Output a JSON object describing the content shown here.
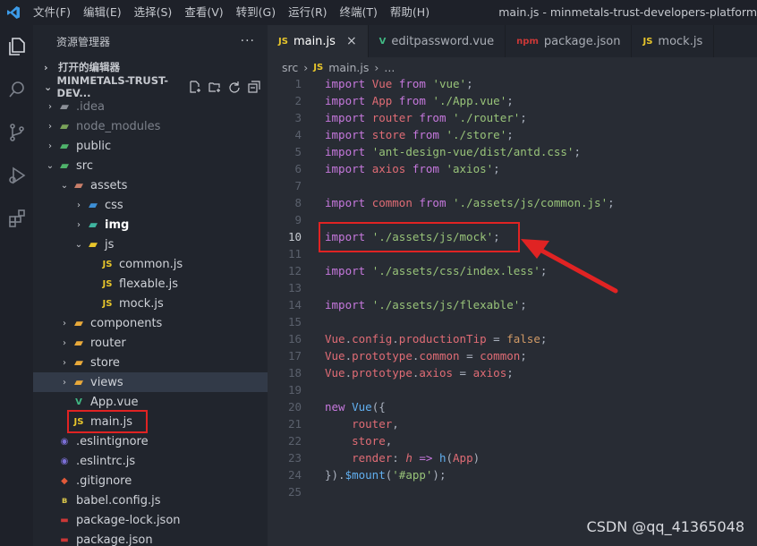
{
  "titlebar": {
    "menu": [
      "文件(F)",
      "编辑(E)",
      "选择(S)",
      "查看(V)",
      "转到(G)",
      "运行(R)",
      "终端(T)",
      "帮助(H)"
    ],
    "window_title": "main.js - minmetals-trust-developers-platform"
  },
  "sidebar": {
    "title": "资源管理器",
    "more": "···",
    "open_editors": "打开的编辑器",
    "project": "MINMETALS-TRUST-DEV...",
    "tree": [
      {
        "label": ".idea",
        "type": "folder",
        "icon": "idea-folder-icon",
        "depth": 1,
        "expanded": false,
        "dim": true
      },
      {
        "label": "node_modules",
        "type": "folder",
        "icon": "node-folder-icon",
        "depth": 1,
        "expanded": false,
        "dim": true
      },
      {
        "label": "public",
        "type": "folder",
        "icon": "public-folder-icon",
        "depth": 1,
        "expanded": false
      },
      {
        "label": "src",
        "type": "folder",
        "icon": "src-folder-icon",
        "depth": 1,
        "expanded": true
      },
      {
        "label": "assets",
        "type": "folder",
        "icon": "assets-folder-icon",
        "depth": 2,
        "expanded": true
      },
      {
        "label": "css",
        "type": "folder",
        "icon": "css-folder-icon",
        "depth": 3,
        "expanded": false
      },
      {
        "label": "img",
        "type": "folder",
        "icon": "img-folder-icon",
        "depth": 3,
        "expanded": false,
        "bold": true
      },
      {
        "label": "js",
        "type": "folder",
        "icon": "js-folder-icon",
        "depth": 3,
        "expanded": true
      },
      {
        "label": "common.js",
        "type": "js",
        "icon": "js-file-icon",
        "depth": 4
      },
      {
        "label": "flexable.js",
        "type": "js",
        "icon": "js-file-icon",
        "depth": 4
      },
      {
        "label": "mock.js",
        "type": "js",
        "icon": "js-file-icon",
        "depth": 4
      },
      {
        "label": "components",
        "type": "folder",
        "icon": "components-folder-icon",
        "depth": 2,
        "expanded": false
      },
      {
        "label": "router",
        "type": "folder",
        "icon": "router-folder-icon",
        "depth": 2,
        "expanded": false
      },
      {
        "label": "store",
        "type": "folder",
        "icon": "store-folder-icon",
        "depth": 2,
        "expanded": false
      },
      {
        "label": "views",
        "type": "folder",
        "icon": "views-folder-icon",
        "depth": 2,
        "expanded": false,
        "selected": true
      },
      {
        "label": "App.vue",
        "type": "vue",
        "icon": "vue-file-icon",
        "depth": 2
      },
      {
        "label": "main.js",
        "type": "js",
        "icon": "js-file-icon",
        "depth": 2,
        "boxed": true
      },
      {
        "label": ".eslintignore",
        "type": "eslint",
        "icon": "eslint-file-icon",
        "depth": 1
      },
      {
        "label": ".eslintrc.js",
        "type": "eslint",
        "icon": "eslint-file-icon",
        "depth": 1
      },
      {
        "label": ".gitignore",
        "type": "git",
        "icon": "git-file-icon",
        "depth": 1
      },
      {
        "label": "babel.config.js",
        "type": "babel",
        "icon": "babel-file-icon",
        "depth": 1
      },
      {
        "label": "package-lock.json",
        "type": "npm",
        "icon": "npm-file-icon",
        "depth": 1
      },
      {
        "label": "package.json",
        "type": "npm",
        "icon": "npm-file-icon",
        "depth": 1
      }
    ]
  },
  "tabs": [
    {
      "label": "main.js",
      "icon": "js-file-icon",
      "badge": "JS",
      "active": true,
      "close": "×"
    },
    {
      "label": "editpassword.vue",
      "icon": "vue-file-icon",
      "badge": "V",
      "active": false
    },
    {
      "label": "package.json",
      "icon": "npm-file-icon",
      "badge": "npm",
      "active": false
    },
    {
      "label": "mock.js",
      "icon": "js-file-icon",
      "badge": "JS",
      "active": false
    }
  ],
  "breadcrumb": {
    "folder": "src",
    "sep": "›",
    "file_badge": "JS",
    "file": "main.js",
    "more": "..."
  },
  "current_line": 10,
  "code_lines": [
    [
      [
        "kw",
        "import "
      ],
      [
        "id",
        "Vue "
      ],
      [
        "kw",
        "from "
      ],
      [
        "str",
        "'vue'"
      ],
      [
        "pl",
        ";"
      ]
    ],
    [
      [
        "kw",
        "import "
      ],
      [
        "id",
        "App "
      ],
      [
        "kw",
        "from "
      ],
      [
        "str",
        "'./App.vue'"
      ],
      [
        "pl",
        ";"
      ]
    ],
    [
      [
        "kw",
        "import "
      ],
      [
        "id",
        "router "
      ],
      [
        "kw",
        "from "
      ],
      [
        "str",
        "'./router'"
      ],
      [
        "pl",
        ";"
      ]
    ],
    [
      [
        "kw",
        "import "
      ],
      [
        "id",
        "store "
      ],
      [
        "kw",
        "from "
      ],
      [
        "str",
        "'./store'"
      ],
      [
        "pl",
        ";"
      ]
    ],
    [
      [
        "kw",
        "import "
      ],
      [
        "str",
        "'ant-design-vue/dist/antd.css'"
      ],
      [
        "pl",
        ";"
      ]
    ],
    [
      [
        "kw",
        "import "
      ],
      [
        "id",
        "axios "
      ],
      [
        "kw",
        "from "
      ],
      [
        "str",
        "'axios'"
      ],
      [
        "pl",
        ";"
      ]
    ],
    [],
    [
      [
        "kw",
        "import "
      ],
      [
        "id",
        "common "
      ],
      [
        "kw",
        "from "
      ],
      [
        "str",
        "'./assets/js/common.js'"
      ],
      [
        "pl",
        ";"
      ]
    ],
    [],
    [
      [
        "kw",
        "import "
      ],
      [
        "str",
        "'./assets/js/mock'"
      ],
      [
        "pl",
        ";"
      ]
    ],
    [],
    [
      [
        "kw",
        "import "
      ],
      [
        "str",
        "'./assets/css/index.less'"
      ],
      [
        "pl",
        ";"
      ]
    ],
    [],
    [
      [
        "kw",
        "import "
      ],
      [
        "str",
        "'./assets/js/flexable'"
      ],
      [
        "pl",
        ";"
      ]
    ],
    [],
    [
      [
        "id",
        "Vue"
      ],
      [
        "pl",
        "."
      ],
      [
        "id",
        "config"
      ],
      [
        "pl",
        "."
      ],
      [
        "id",
        "productionTip "
      ],
      [
        "pl",
        "= "
      ],
      [
        "num",
        "false"
      ],
      [
        "pl",
        ";"
      ]
    ],
    [
      [
        "id",
        "Vue"
      ],
      [
        "pl",
        "."
      ],
      [
        "id",
        "prototype"
      ],
      [
        "pl",
        "."
      ],
      [
        "id",
        "common "
      ],
      [
        "pl",
        "= "
      ],
      [
        "id",
        "common"
      ],
      [
        "pl",
        ";"
      ]
    ],
    [
      [
        "id",
        "Vue"
      ],
      [
        "pl",
        "."
      ],
      [
        "id",
        "prototype"
      ],
      [
        "pl",
        "."
      ],
      [
        "id",
        "axios "
      ],
      [
        "pl",
        "= "
      ],
      [
        "id",
        "axios"
      ],
      [
        "pl",
        ";"
      ]
    ],
    [],
    [
      [
        "kw",
        "new "
      ],
      [
        "fn",
        "Vue"
      ],
      [
        "pl",
        "({"
      ]
    ],
    [
      [
        "pl",
        "    "
      ],
      [
        "id",
        "router"
      ],
      [
        "pl",
        ","
      ]
    ],
    [
      [
        "pl",
        "    "
      ],
      [
        "id",
        "store"
      ],
      [
        "pl",
        ","
      ]
    ],
    [
      [
        "pl",
        "    "
      ],
      [
        "id",
        "render"
      ],
      [
        "pl",
        ": "
      ],
      [
        "it",
        "h "
      ],
      [
        "kw",
        "=> "
      ],
      [
        "fn",
        "h"
      ],
      [
        "pl",
        "("
      ],
      [
        "id",
        "App"
      ],
      [
        "pl",
        ")"
      ]
    ],
    [
      [
        "pl",
        "})."
      ],
      [
        "fn",
        "$mount"
      ],
      [
        "pl",
        "("
      ],
      [
        "str",
        "'#app'"
      ],
      [
        "pl",
        ");"
      ]
    ],
    []
  ],
  "watermark": "CSDN @qq_41365048",
  "colors": {
    "annotation_red": "#e02323",
    "js_yellow": "#e8c62b",
    "vue_green": "#41b883"
  }
}
